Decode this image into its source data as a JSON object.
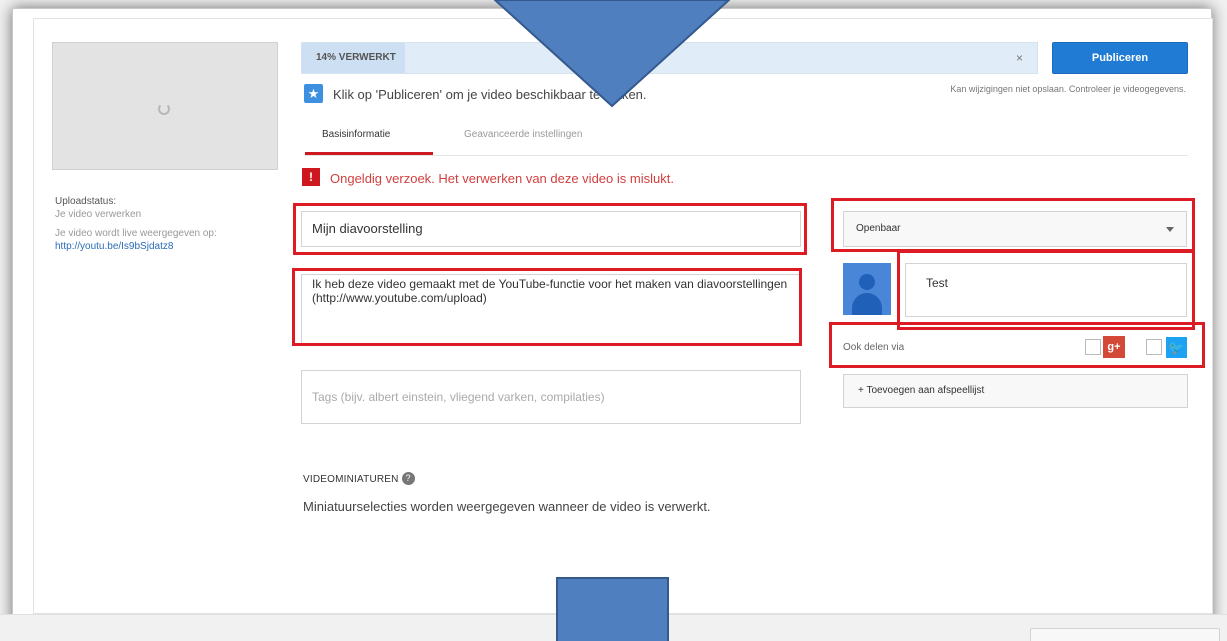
{
  "upload": {
    "progress_text": "14% VERWERKT",
    "progress_fraction": 0.14,
    "close_symbol": "×",
    "publish_label": "Publiceren",
    "notice_icon": "★",
    "notice_text": "Klik op 'Publiceren' om je video beschikbaar te maken.",
    "save_note": "Kan wijzigingen niet opslaan. Controleer je videogegevens."
  },
  "tabs": [
    {
      "label": "Basisinformatie"
    },
    {
      "label": "Geavanceerde instellingen"
    }
  ],
  "error": {
    "icon": "!",
    "text": "Ongeldig verzoek. Het verwerken van deze video is mislukt."
  },
  "sidebar": {
    "status_label": "Uploadstatus:",
    "status_processing": "Je video verwerken",
    "status_live": "Je video wordt live weergegeven op:",
    "video_link": "http://youtu.be/Is9bSjdatz8"
  },
  "form": {
    "title_value": "Mijn diavoorstelling",
    "description_value": "Ik heb deze video gemaakt met de YouTube-functie voor het maken van diavoorstellingen (http://www.youtube.com/upload)",
    "tags_placeholder": "Tags (bijv. albert einstein, vliegend varken, compilaties)",
    "privacy_selected": "Openbaar",
    "share_message": "Test",
    "share_label": "Ook delen via",
    "gplus_text": "g+",
    "twitter_text": "🐦",
    "playlist_label": "+ Toevoegen aan afspeellijst"
  },
  "thumbnails": {
    "heading": "VIDEOMINIATUREN",
    "help_icon": "?",
    "text": "Miniatuurselecties worden weergegeven wanneer de video is verwerkt."
  },
  "colors": {
    "publish_blue": "#1f7bd3",
    "error_red": "#cc181e",
    "highlight_red": "#dd1b24",
    "arrow_blue": "#4f7fbf"
  },
  "icons": [
    "spinner-icon",
    "star-icon",
    "error-icon",
    "chevron-down-icon",
    "avatar-icon",
    "google-plus-icon",
    "twitter-icon",
    "help-icon"
  ]
}
